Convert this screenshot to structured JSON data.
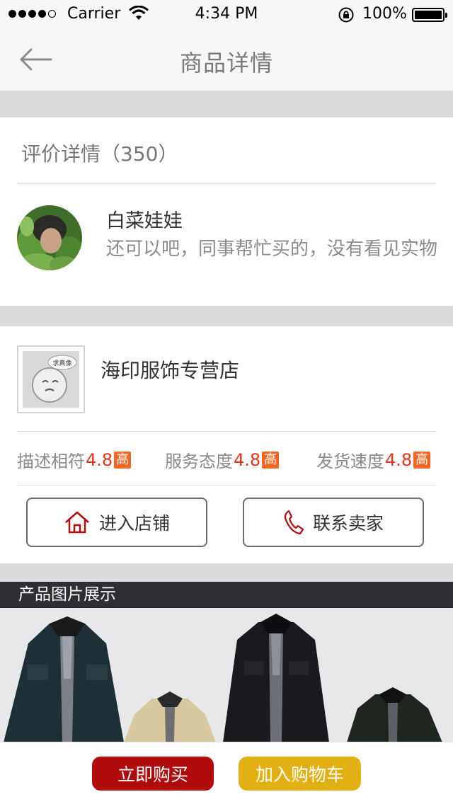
{
  "status_bar": {
    "carrier": "Carrier",
    "time": "4:34 PM",
    "battery": "100%",
    "signal_icon": "signal-dots-icon",
    "wifi_icon": "wifi-icon",
    "lock_icon": "orientation-lock-icon",
    "battery_icon": "battery-icon"
  },
  "nav": {
    "title": "商品详情",
    "back_icon": "arrow-left-icon"
  },
  "review": {
    "heading": "评价详情（350）",
    "reviewer_name": "白菜娃娃",
    "comment": "还可以吧，同事帮忙买的，没有看见实物",
    "avatar_icon": "user-avatar-photo"
  },
  "shop": {
    "name": "海印服饰专营店",
    "logo_text": "求真像",
    "ratings": [
      {
        "label": "描述相符",
        "value": "4.8",
        "tag": "高"
      },
      {
        "label": "服务态度",
        "value": "4.8",
        "tag": "高"
      },
      {
        "label": "发货速度",
        "value": "4.8",
        "tag": "高"
      }
    ],
    "enter_store_label": "进入店铺",
    "contact_seller_label": "联系卖家",
    "enter_store_icon": "home-icon",
    "contact_seller_icon": "phone-icon"
  },
  "products": {
    "section_title": "产品图片展示"
  },
  "bottom_bar": {
    "buy_now_label": "立即购买",
    "add_to_cart_label": "加入购物车"
  },
  "colors": {
    "accent_red": "#b20b0e",
    "accent_yellow": "#e2b013",
    "rating_value": "#e9331d",
    "rating_tag": "#f26522",
    "section_dark": "#2d2f33"
  }
}
